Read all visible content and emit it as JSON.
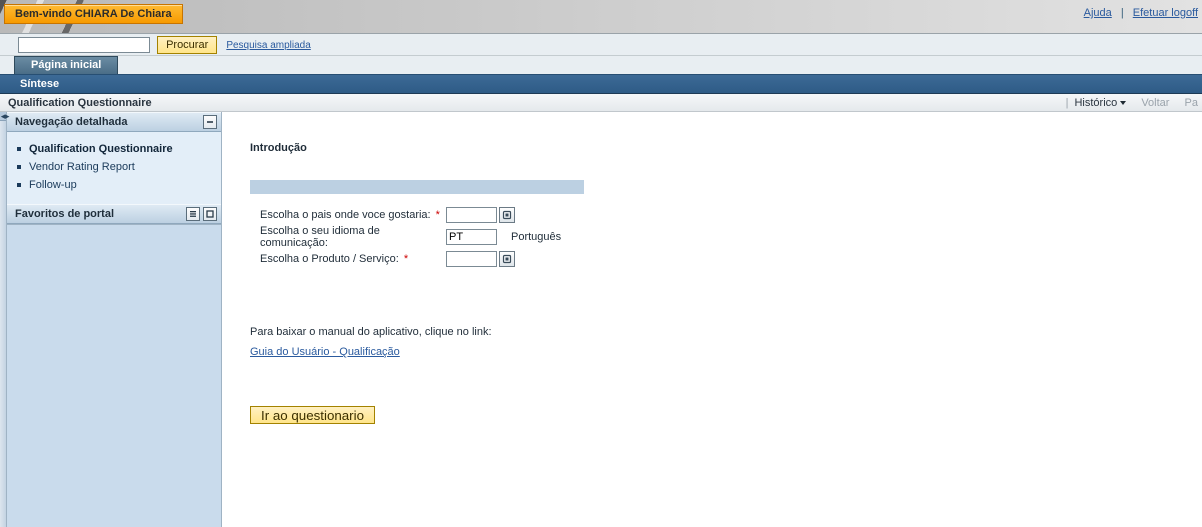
{
  "masthead": {
    "welcome": "Bem-vindo CHIARA De Chiara",
    "help": "Ajuda",
    "logoff": "Efetuar logoff"
  },
  "search": {
    "value": "",
    "button": "Procurar",
    "advanced": "Pesquisa ampliada"
  },
  "tabs": {
    "primary": "Página inicial",
    "secondary": "Síntese"
  },
  "titlebar": {
    "title": "Qualification Questionnaire",
    "history": "Histórico",
    "back": "Voltar",
    "forward": "Pa"
  },
  "sidebar": {
    "nav_header": "Navegação detalhada",
    "items": [
      {
        "label": "Qualification Questionnaire",
        "active": true
      },
      {
        "label": "Vendor Rating Report",
        "active": false
      },
      {
        "label": "Follow-up",
        "active": false
      }
    ],
    "fav_header": "Favoritos de portal"
  },
  "content": {
    "heading": "Introdução",
    "rows": {
      "country_label": "Escolha o pais onde voce gostaria:",
      "country_value": "",
      "lang_label": "Escolha o seu idioma de comunicação:",
      "lang_value": "PT",
      "lang_name": "Português",
      "product_label": "Escolha o Produto / Serviço:",
      "product_value": ""
    },
    "manual_text": "Para baixar o manual do aplicativo, clique no link:",
    "manual_link": "Guia do Usuário - Qualificação",
    "go_button": "Ir ao questionario"
  }
}
